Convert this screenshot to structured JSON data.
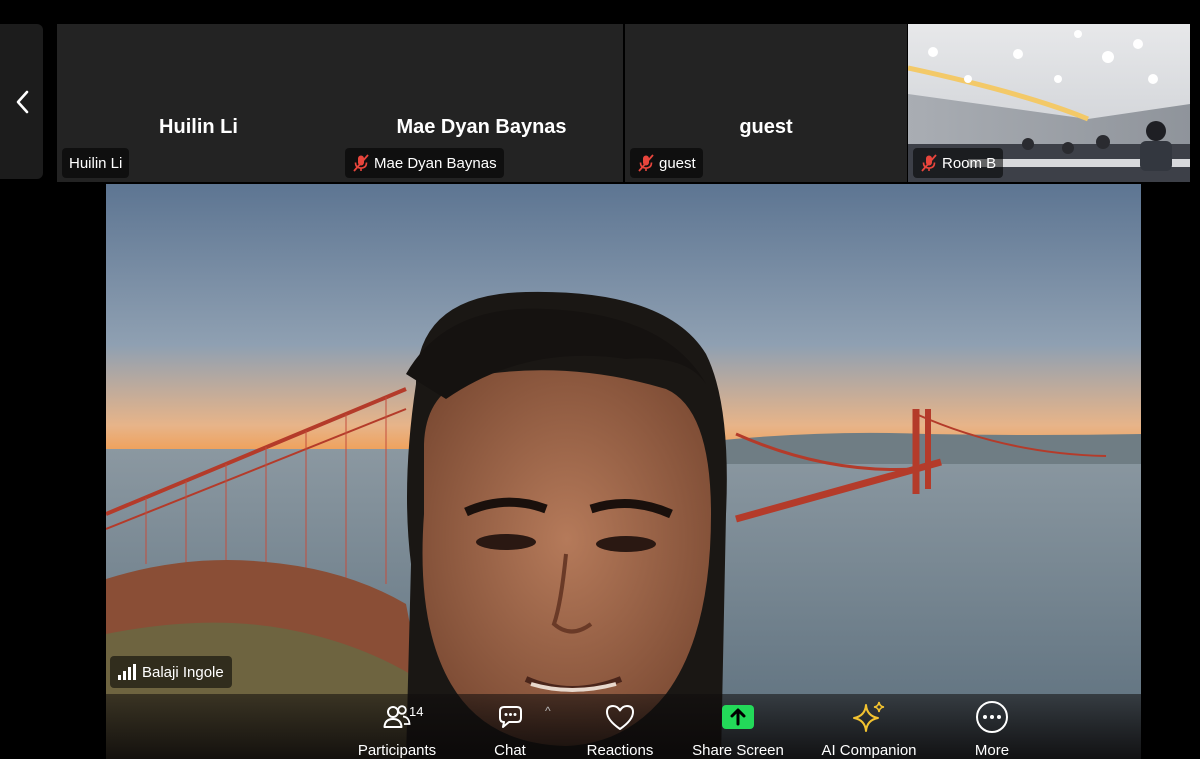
{
  "gallery": {
    "tiles": [
      {
        "display_name": "Huilin Li",
        "tag": "Huilin Li",
        "muted": false
      },
      {
        "display_name": "Mae Dyan Baynas",
        "tag": "Mae Dyan Baynas",
        "muted": true
      },
      {
        "display_name": "guest",
        "tag": "guest",
        "muted": true
      },
      {
        "display_name": "",
        "tag": "Room B",
        "muted": true,
        "video": true
      }
    ]
  },
  "speaker": {
    "name": "Balaji Ingole"
  },
  "toolbar": {
    "participants_label": "Participants",
    "participants_count": "14",
    "chat_label": "Chat",
    "reactions_label": "Reactions",
    "share_label": "Share Screen",
    "ai_label": "AI Companion",
    "more_label": "More"
  },
  "colors": {
    "share_green": "#23d959",
    "ai_gold": "#f2c230",
    "mute_red": "#e8453c",
    "tile_bg": "#232323"
  }
}
